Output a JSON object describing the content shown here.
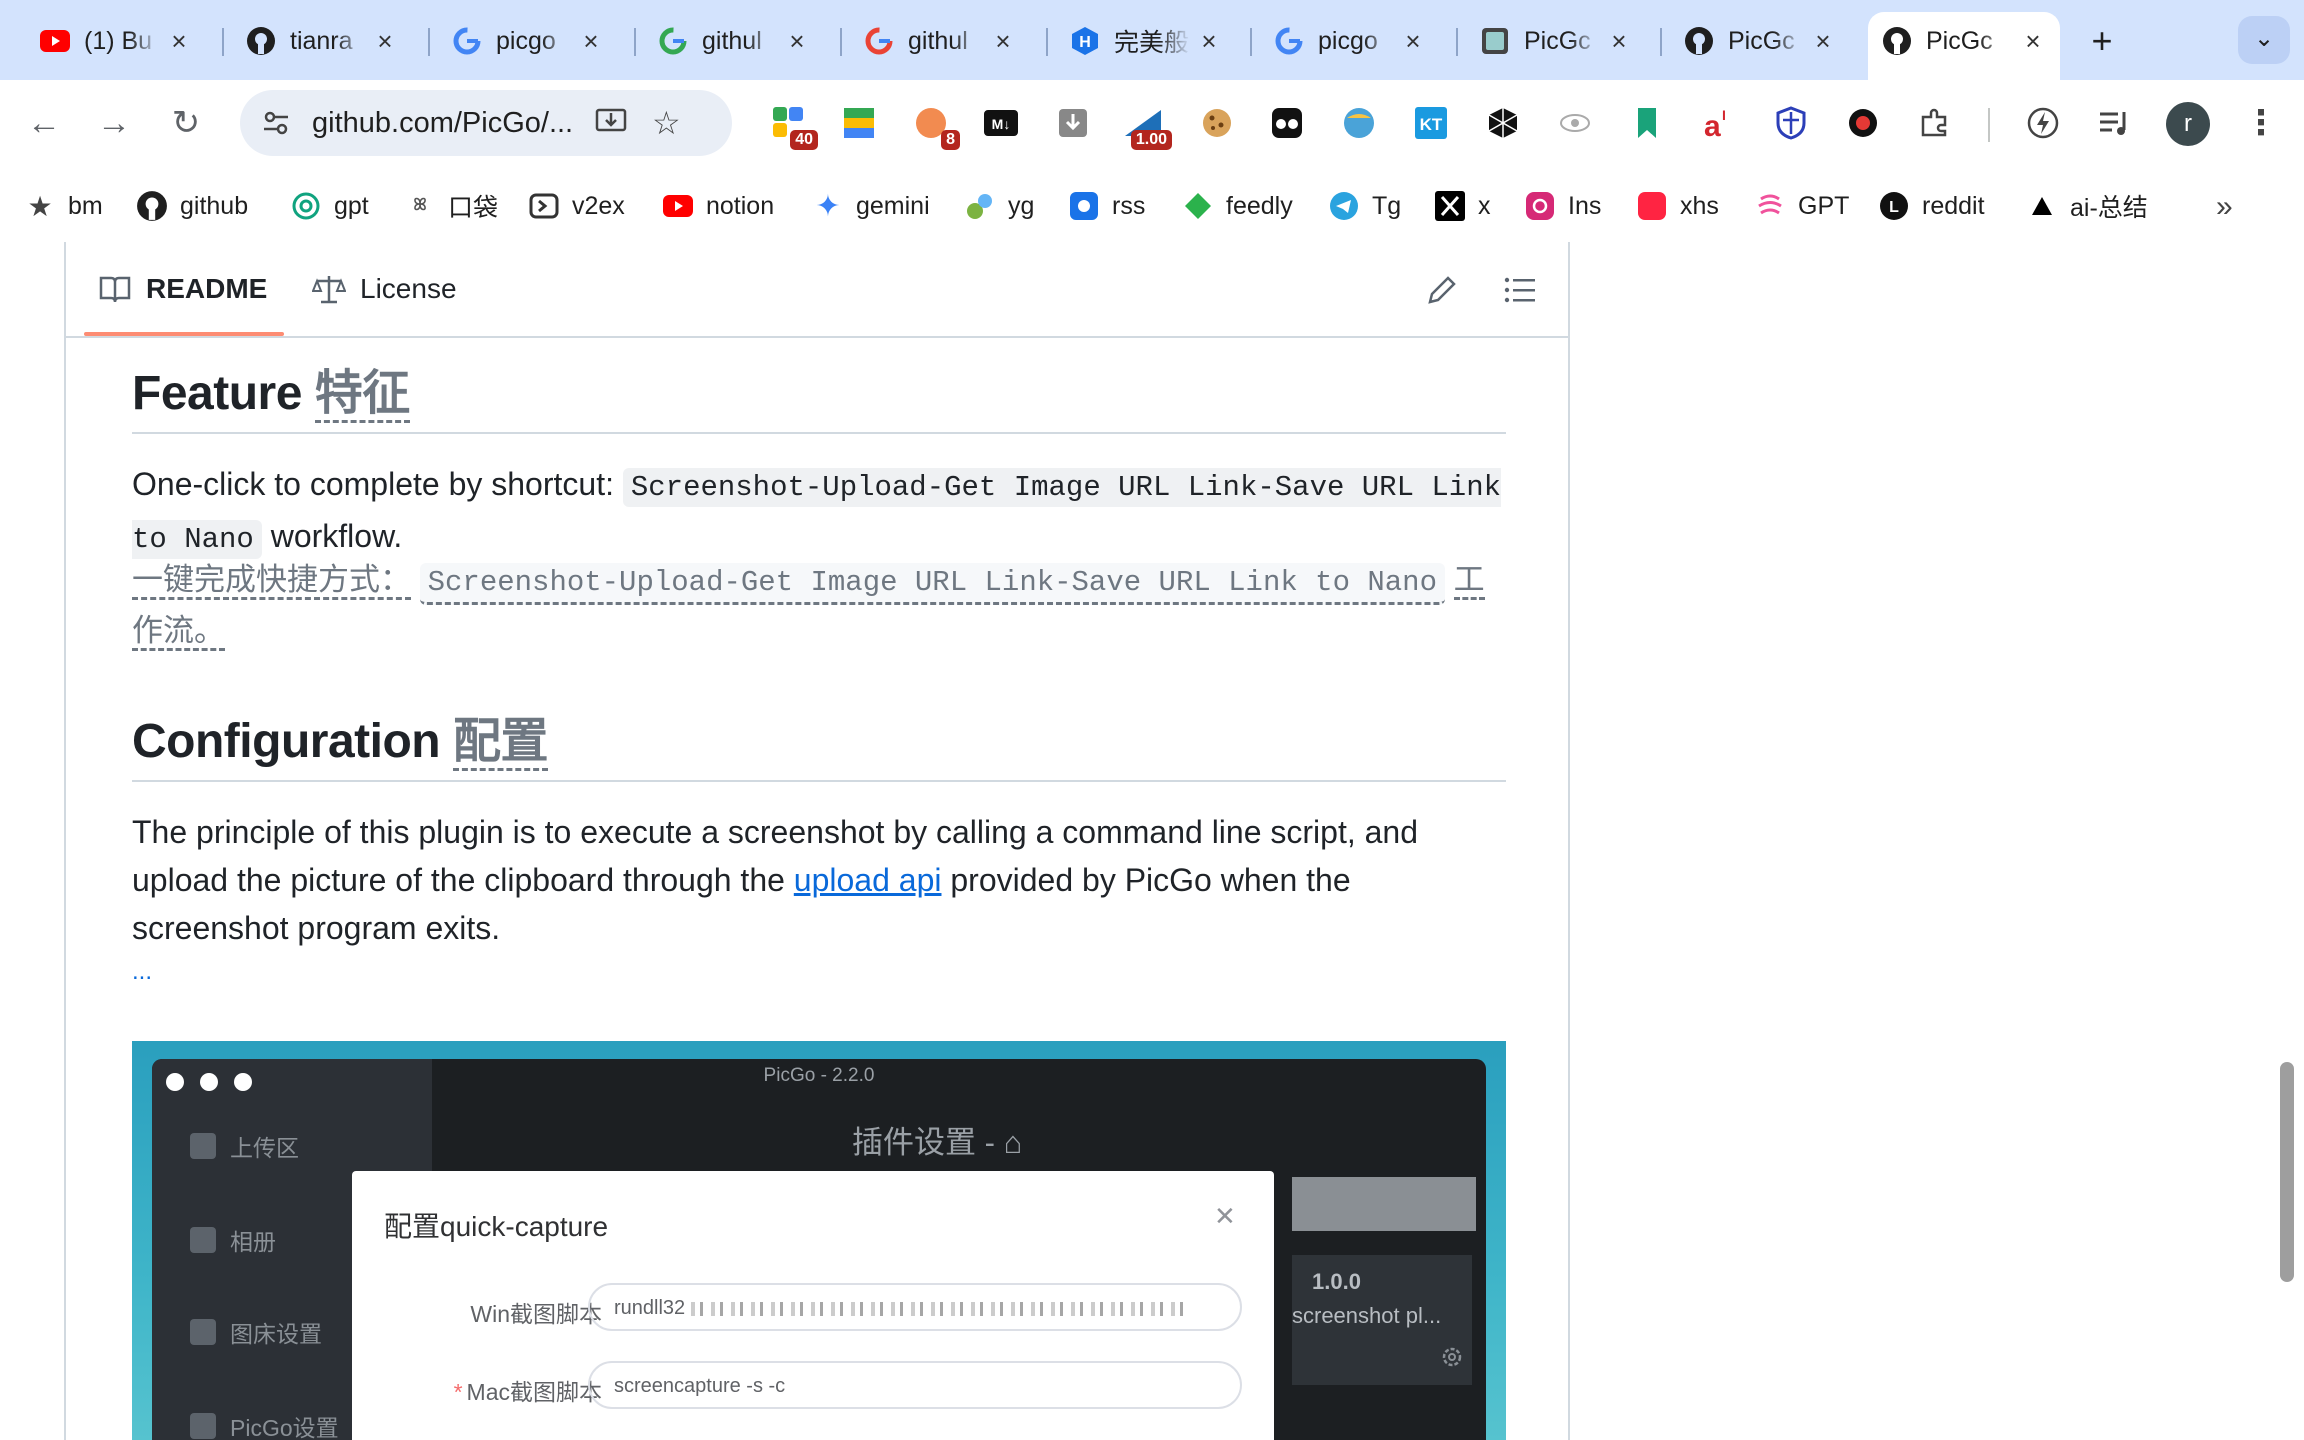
{
  "tabs": [
    {
      "label": "(1) Bu",
      "icon": "youtube-icon",
      "active": false
    },
    {
      "label": "tianra",
      "icon": "github-icon",
      "active": false
    },
    {
      "label": "picgo",
      "icon": "google-icon",
      "active": false
    },
    {
      "label": "githul",
      "icon": "google-icon",
      "active": false
    },
    {
      "label": "githul",
      "icon": "google-icon",
      "active": false
    },
    {
      "label": "完美般",
      "icon": "h-icon",
      "active": false
    },
    {
      "label": "picgo",
      "icon": "google-icon",
      "active": false
    },
    {
      "label": "PicGc",
      "icon": "picgo-icon",
      "active": false
    },
    {
      "label": "PicGc",
      "icon": "github-icon",
      "active": false
    },
    {
      "label": "PicGc",
      "icon": "github-icon",
      "active": true
    }
  ],
  "toolbar": {
    "url": "github.com/PicGo/...",
    "extension_badges": {
      "ext1": "40",
      "ext3": "8",
      "ext7": "1.00"
    },
    "profile_initial": "r"
  },
  "bookmarks": [
    {
      "label": "bm",
      "icon": "star-icon"
    },
    {
      "label": "github",
      "icon": "github-icon"
    },
    {
      "label": "gpt",
      "icon": "openai-icon"
    },
    {
      "label": "口袋",
      "icon": "pocket-icon"
    },
    {
      "label": "v2ex",
      "icon": "v2ex-icon"
    },
    {
      "label": "notion",
      "icon": "youtube-icon"
    },
    {
      "label": "gemini",
      "icon": "gemini-icon"
    },
    {
      "label": "yg",
      "icon": "yg-icon"
    },
    {
      "label": "rss",
      "icon": "rss-icon"
    },
    {
      "label": "feedly",
      "icon": "feedly-icon"
    },
    {
      "label": "Tg",
      "icon": "telegram-icon"
    },
    {
      "label": "x",
      "icon": "x-icon"
    },
    {
      "label": "Ins",
      "icon": "instagram-icon"
    },
    {
      "label": "xhs",
      "icon": "xhs-icon"
    },
    {
      "label": "GPT",
      "icon": "gpt-icon"
    },
    {
      "label": "reddit",
      "icon": "reddit-icon"
    },
    {
      "label": "ai-总结",
      "icon": "triangle-icon"
    }
  ],
  "readme": {
    "tab_readme": "README",
    "tab_license": "License",
    "feature_heading": "Feature",
    "feature_heading_zh": "特征",
    "feature_p1_a": "One-click to complete by shortcut: ",
    "feature_code": "Screenshot-Upload-Get Image URL Link-Save URL Link to Nano",
    "feature_p1_b": " workflow.",
    "feature_zh_a": "一键完成快捷方式：",
    "feature_zh_code": "Screenshot-Upload-Get Image URL Link-Save URL Link to Nano",
    "feature_zh_b": "工作流。",
    "config_heading": "Configuration",
    "config_heading_zh": "配置",
    "config_p_a": "The principle of this plugin is to execute a screenshot by calling a command line script, and upload the picture of the clipboard through the ",
    "config_link": "upload api",
    "config_p_b": " provided by PicGo when the screenshot program exits.",
    "ellipsis": "...",
    "screenshot": {
      "window_title": "PicGo - 2.2.0",
      "plugin_title": "插件设置 -",
      "sidebar": [
        "上传区",
        "相册",
        "图床设置",
        "PicGo设置"
      ],
      "card_version": "1.0.0",
      "card_desc": "screenshot pl...",
      "dialog_title": "配置quick-capture",
      "win_label": "Win截图脚本",
      "win_value": "rundll32",
      "mac_label": "Mac截图脚本",
      "mac_value": "screencapture -s -c"
    }
  },
  "colors": {
    "tabstrip": "#d3e3fd",
    "link": "#0969da",
    "accent": "#fd8c73"
  }
}
